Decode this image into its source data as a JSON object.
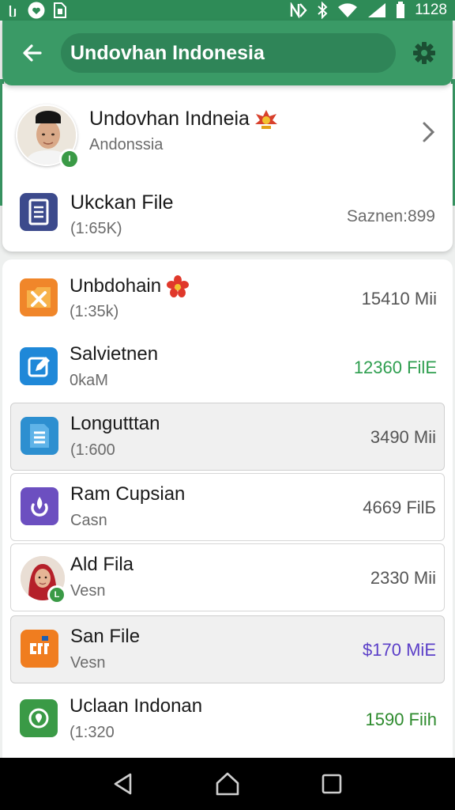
{
  "status_bar": {
    "time": "1128",
    "left_icons": [
      "notification-icon",
      "heart-icon",
      "sim-icon"
    ],
    "right_icons": [
      "nfc-icon",
      "bluetooth-icon",
      "wifi-icon",
      "signal-icon",
      "battery-icon"
    ]
  },
  "app_bar": {
    "title": "Undovhan Indonesia",
    "back_icon": "arrow-back-icon",
    "settings_icon": "gear-icon"
  },
  "profile": {
    "name": "Undovhan Indneia",
    "subtitle": "Andonssia",
    "badge_icon": "emblem-icon",
    "status_glyph": "I"
  },
  "pinned_file": {
    "title": "Ukckan File",
    "subtitle": "(1:65K)",
    "value": "Saznen:899",
    "icon": "document-icon"
  },
  "items": [
    {
      "title": "Unbdohain",
      "subtitle": "(1:35k)",
      "value": "15410 Mii",
      "icon": "tools-folder-icon",
      "icon_color": "#f0862a",
      "value_color": "#555555",
      "flower": true
    },
    {
      "title": "Salvietnen",
      "subtitle": "0kaM",
      "value": "12360 FilE",
      "icon": "edit-icon",
      "icon_color": "#1f88d8",
      "value_color": "#2e9e4f"
    },
    {
      "title": "Longutttan",
      "subtitle": "(1:600",
      "value": "3490 Mii",
      "icon": "list-doc-icon",
      "icon_color": "#2d8fd0",
      "value_color": "#555555"
    },
    {
      "title": "Ram Cupsian",
      "subtitle": "Casn",
      "value": "4669 FilБ",
      "icon": "flame-icon",
      "icon_color": "#6c4fc0",
      "value_color": "#555555"
    },
    {
      "title": "Ald Fila",
      "subtitle": "Vesn",
      "value": "2330 Mii",
      "icon": "avatar",
      "value_color": "#555555",
      "status_glyph": "L"
    },
    {
      "title": "San File",
      "subtitle": "Vesn",
      "value": "$170 MiE",
      "icon": "code-file-icon",
      "icon_color": "#f07d1f",
      "value_color": "#5b3fc8"
    },
    {
      "title": "Uclaan Indonan",
      "subtitle": "(1:320",
      "value": "1590 Fiih",
      "icon": "location-icon",
      "icon_color": "#3a9a46",
      "value_color": "#2e8b2e"
    }
  ],
  "nav": [
    "back-nav-icon",
    "home-nav-icon",
    "recents-nav-icon"
  ]
}
